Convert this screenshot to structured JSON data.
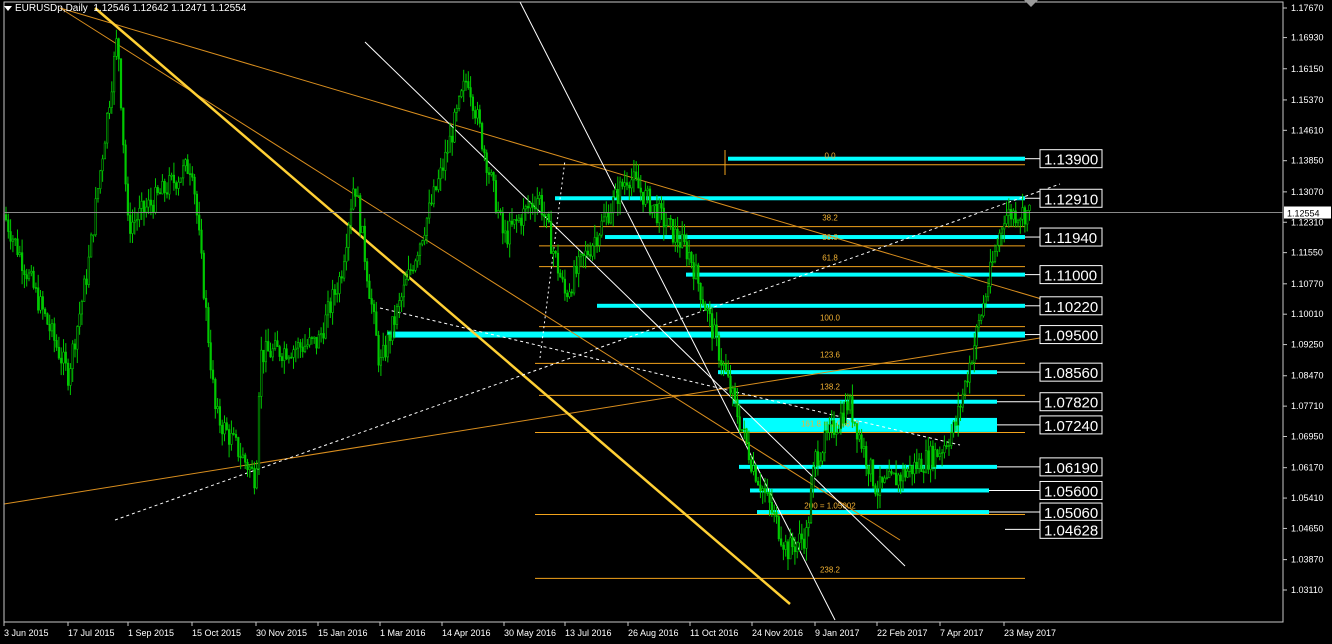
{
  "window": {
    "symbol": "EURUSDp,Daily",
    "ohlc": "1.12546 1.12642 1.12471 1.12554"
  },
  "colors": {
    "background": "#000000",
    "candle": "#00c800",
    "level_line": "#00ffff",
    "fib_line": "#f2a31b",
    "trend_thin": "#d98e1e",
    "trend_thick": "#ffd035",
    "trend_white": "#ffffff",
    "grid_text": "#ffffff",
    "fib_text": "#f2b132"
  },
  "chart_data": {
    "type": "line",
    "title": "",
    "ylim": [
      1.0311,
      1.1767
    ],
    "current_price": "1.12554",
    "y_ticks": [
      "1.17670",
      "1.16930",
      "1.16150",
      "1.15370",
      "1.14610",
      "1.13850",
      "1.13070",
      "1.12310",
      "1.11550",
      "1.10770",
      "1.10010",
      "1.09250",
      "1.08470",
      "1.07710",
      "1.06950",
      "1.06170",
      "1.05410",
      "1.04650",
      "1.03870",
      "1.03110"
    ],
    "x_ticks": [
      "3 Jun 2015",
      "17 Jul 2015",
      "1 Sep 2015",
      "15 Oct 2015",
      "30 Nov 2015",
      "15 Jan 2016",
      "1 Mar 2016",
      "14 Apr 2016",
      "30 May 2016",
      "13 Jul 2016",
      "26 Aug 2016",
      "11 Oct 2016",
      "24 Nov 2016",
      "9 Jan 2017",
      "22 Feb 2017",
      "7 Apr 2017",
      "23 May 2017"
    ],
    "series": [
      {
        "x": [
          "3 Jun 2015",
          "17 Jul 2015",
          "1 Aug 2015",
          "24 Aug 2015",
          "1 Sep 2015",
          "15 Oct 2015",
          "1 Nov 2015",
          "30 Nov 2015",
          "3 Dec 2015",
          "15 Jan 2016",
          "1 Feb 2016",
          "11 Feb 2016",
          "1 Mar 2016",
          "14 Apr 2016",
          "3 May 2016",
          "30 May 2016",
          "24 Jun 2016",
          "13 Jul 2016",
          "26 Aug 2016",
          "11 Oct 2016",
          "24 Nov 2016",
          "20 Dec 2016",
          "3 Jan 2017",
          "9 Jan 2017",
          "2 Feb 2017",
          "22 Feb 2017",
          "7 Apr 2017",
          "18 Apr 2017",
          "23 May 2017",
          "2 Jun 2017"
        ],
        "y": [
          1.125,
          1.085,
          1.111,
          1.17,
          1.122,
          1.138,
          1.075,
          1.059,
          1.09,
          1.093,
          1.11,
          1.134,
          1.087,
          1.136,
          1.16,
          1.119,
          1.13,
          1.105,
          1.135,
          1.115,
          1.063,
          1.041,
          1.045,
          1.064,
          1.078,
          1.056,
          1.066,
          1.072,
          1.125,
          1.1255
        ]
      }
    ],
    "levels": [
      {
        "price": 1.139,
        "label": "1.13900"
      },
      {
        "price": 1.1291,
        "label": "1.12910"
      },
      {
        "price": 1.1194,
        "label": "1.11940"
      },
      {
        "price": 1.11,
        "label": "1.11000"
      },
      {
        "price": 1.1022,
        "label": "1.10220"
      },
      {
        "price": 1.095,
        "label": "1.09500"
      },
      {
        "price": 1.0856,
        "label": "1.08560"
      },
      {
        "price": 1.0782,
        "label": "1.07820"
      },
      {
        "price": 1.0724,
        "label": "1.07240"
      },
      {
        "price": 1.0619,
        "label": "1.06190"
      },
      {
        "price": 1.056,
        "label": "1.05600"
      },
      {
        "price": 1.0506,
        "label": "1.05060"
      },
      {
        "price": 1.04628,
        "label": "1.04628"
      }
    ],
    "fib_labels": [
      {
        "price": 1.1395,
        "text": "0.0"
      },
      {
        "price": 1.124,
        "text": "38.2"
      },
      {
        "price": 1.1192,
        "text": "50.0"
      },
      {
        "price": 1.114,
        "text": "61.8"
      },
      {
        "price": 1.099,
        "text": "100.0"
      },
      {
        "price": 1.0898,
        "text": "123.6"
      },
      {
        "price": 1.0818,
        "text": "138.2"
      },
      {
        "price": 1.0725,
        "text": "161.8 = 1.06819"
      },
      {
        "price": 1.052,
        "text": "200 = 1.05002"
      },
      {
        "price": 1.036,
        "text": "238.2"
      }
    ]
  }
}
